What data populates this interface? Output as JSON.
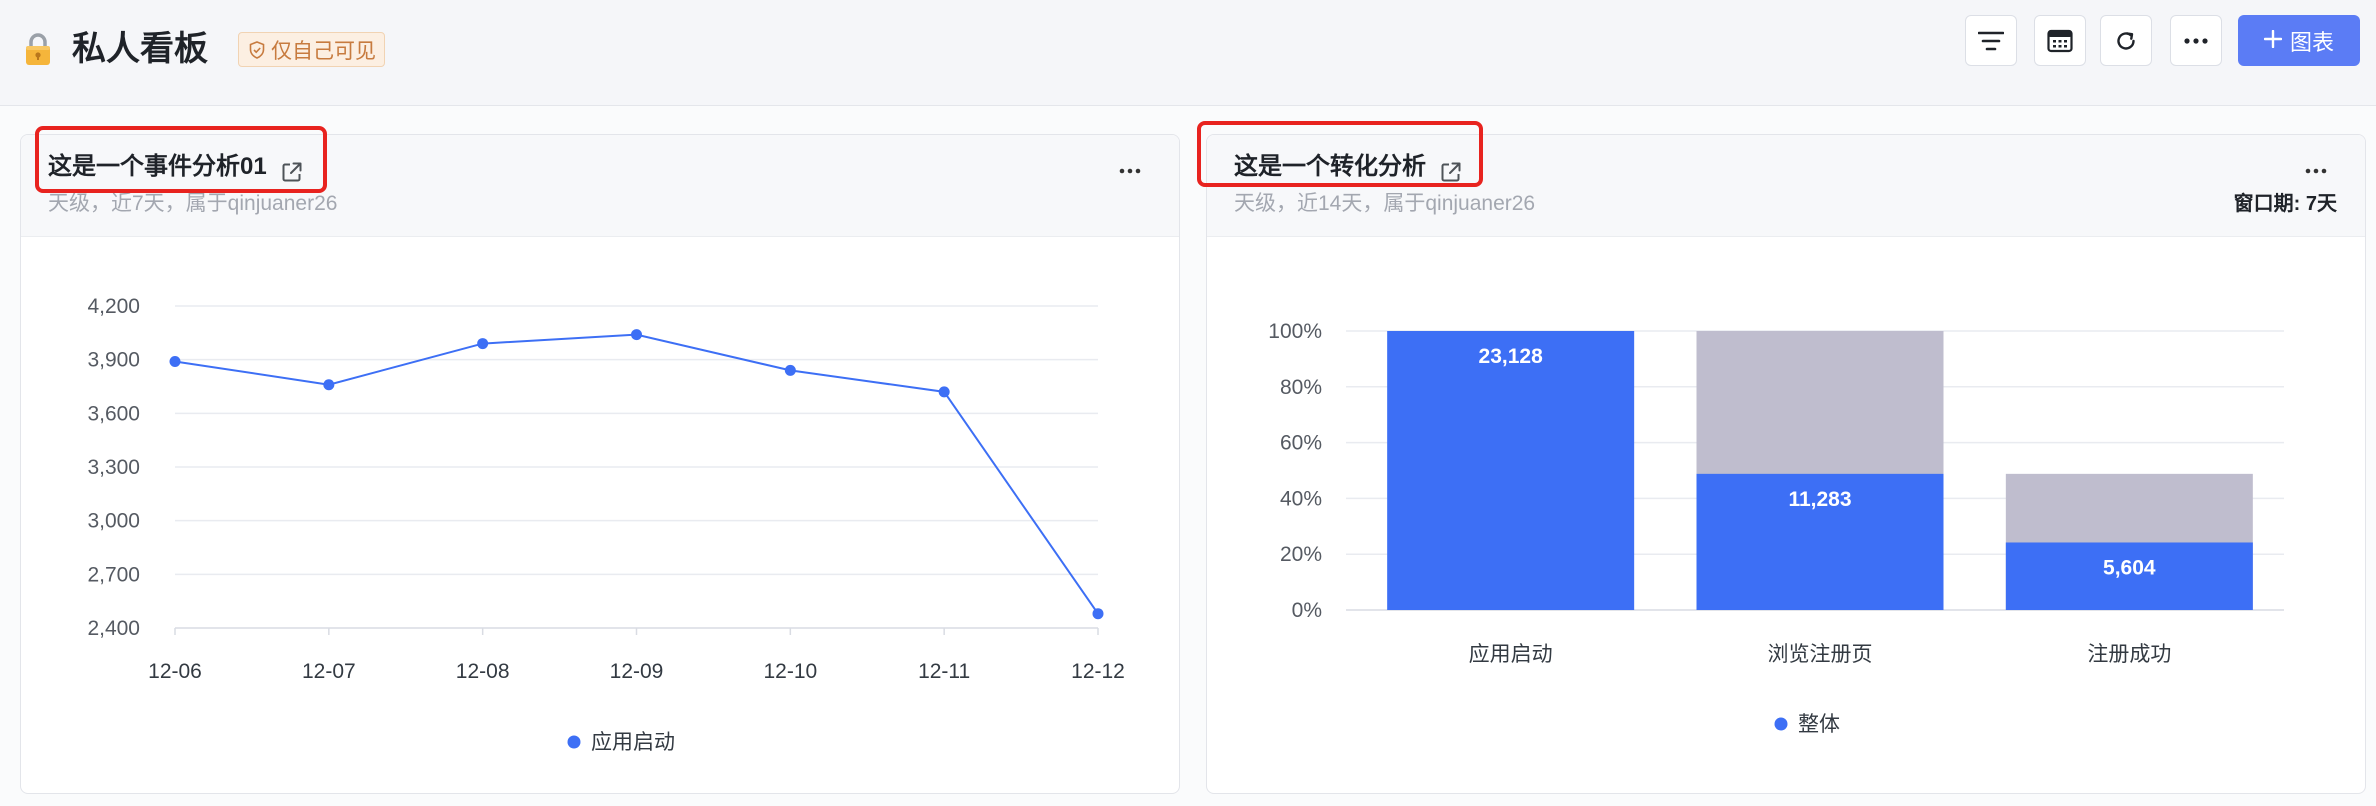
{
  "header": {
    "title": "私人看板",
    "badge": "仅自己可见",
    "add_chart_label": "图表",
    "icons": [
      "lock-icon",
      "shield-check-icon",
      "filter-icon",
      "calendar-icon",
      "refresh-icon",
      "more-icon",
      "plus-icon"
    ]
  },
  "colors": {
    "accent": "#3d6ff5",
    "add_button": "#5b7cf5",
    "bar_remaining": "#bfbdce",
    "badge_text": "#c77b3f",
    "highlight": "#e8231f"
  },
  "chart_data": [
    {
      "type": "line",
      "title": "这是一个事件分析01",
      "subtitle": "天级，近7天，属于qinjuaner26",
      "categories": [
        "12-06",
        "12-07",
        "12-08",
        "12-09",
        "12-10",
        "12-11",
        "12-12"
      ],
      "series": [
        {
          "name": "应用启动",
          "values": [
            3890,
            3760,
            3990,
            4040,
            3840,
            3720,
            2480
          ]
        }
      ],
      "ylim": [
        2400,
        4200
      ],
      "ytick_labels": [
        "2,400",
        "2,700",
        "3,000",
        "3,300",
        "3,600",
        "3,900",
        "4,200"
      ],
      "grid": true,
      "legend": "bottom"
    },
    {
      "type": "bar",
      "title": "这是一个转化分析",
      "subtitle": "天级，近14天，属于qinjuaner26",
      "window_period": "窗口期: 7天",
      "categories": [
        "应用启动",
        "浏览注册页",
        "注册成功"
      ],
      "series": [
        {
          "name": "整体",
          "values": [
            23128,
            11283,
            5604
          ]
        }
      ],
      "conversion_percent": [
        100,
        48.8,
        24.2
      ],
      "ylim": [
        0,
        100
      ],
      "ytick_labels": [
        "0%",
        "20%",
        "40%",
        "60%",
        "80%",
        "100%"
      ],
      "grid": true,
      "legend": "bottom"
    }
  ]
}
